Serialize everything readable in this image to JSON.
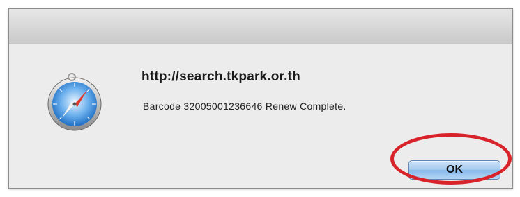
{
  "dialog": {
    "title": "http://search.tkpark.or.th",
    "message": "Barcode 32005001236646 Renew Complete.",
    "ok_label": "OK"
  },
  "icons": {
    "app_icon": "safari-compass-icon"
  },
  "colors": {
    "annotation_ring": "#d8232a",
    "button_accent": "#86b8ea"
  }
}
